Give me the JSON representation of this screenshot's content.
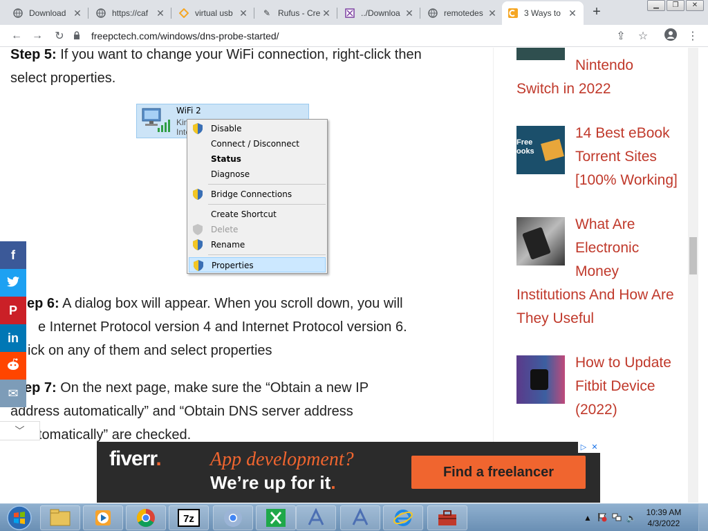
{
  "browser": {
    "tabs": [
      {
        "title": "Download",
        "icon": "globe-icon",
        "active": false
      },
      {
        "title": "https://caf",
        "icon": "globe-icon",
        "active": false
      },
      {
        "title": "virtual usb",
        "icon": "diamond-icon",
        "active": false
      },
      {
        "title": "Rufus - Cre",
        "icon": "pen-icon",
        "active": false
      },
      {
        "title": "../Downloa",
        "icon": "folder-icon",
        "active": false
      },
      {
        "title": "remotedes",
        "icon": "globe-icon",
        "active": false
      },
      {
        "title": "3 Ways to",
        "icon": "site-icon",
        "active": true
      }
    ],
    "new_tab_glyph": "+",
    "url": "freepctech.com/windows/dns-probe-started/"
  },
  "article": {
    "step5_label": "Step 5:",
    "step5_text": " If you want to change your WiFi connection, right-click then select properties.",
    "step6_label": "Step 6:",
    "step6_text": " A dialog box will appear. When you scroll down, you will see Internet Protocol version 4 and Internet Protocol version 6. Click on any of them and select properties",
    "step6_visible_a": "ep 6:",
    "step6_visible_b": " A dialog box will appear. When you scroll down, you will",
    "step6_visible_c": "e Internet Protocol version 4 and Internet Protocol version 6.",
    "step6_visible_d": "ick on any of them and select properties",
    "step7_label": "Step 7:",
    "step7_line1": " On the next page, make sure the “Obtain a new IP",
    "step7_line2": "address automatically” and “Obtain DNS server address",
    "step7_line3": "tomatically” are checked."
  },
  "context_menu": {
    "wifi_name": "WiFi 2",
    "wifi_sub1": "Kin",
    "wifi_sub2": "Inte",
    "items": [
      {
        "label": "Disable",
        "shield": true,
        "style": "normal"
      },
      {
        "label": "Connect / Disconnect",
        "shield": false,
        "style": "normal"
      },
      {
        "label": "Status",
        "shield": false,
        "style": "bold"
      },
      {
        "label": "Diagnose",
        "shield": false,
        "style": "normal"
      },
      {
        "label": "Bridge Connections",
        "shield": true,
        "style": "normal"
      },
      {
        "label": "Create Shortcut",
        "shield": false,
        "style": "normal"
      },
      {
        "label": "Delete",
        "shield": true,
        "style": "disabled"
      },
      {
        "label": "Rename",
        "shield": true,
        "style": "normal"
      },
      {
        "label": "Properties",
        "shield": true,
        "style": "highlighted"
      }
    ]
  },
  "social": [
    {
      "name": "facebook",
      "glyph": "f",
      "color": "#3b5998"
    },
    {
      "name": "twitter",
      "glyph": "🐦",
      "color": "#1da1f2"
    },
    {
      "name": "pinterest",
      "glyph": "P",
      "color": "#cb2027"
    },
    {
      "name": "linkedin",
      "glyph": "in",
      "color": "#0077b5"
    },
    {
      "name": "reddit",
      "glyph": "●",
      "color": "#ff4500"
    },
    {
      "name": "email",
      "glyph": "✉",
      "color": "#7d9cb8"
    }
  ],
  "sidebar": {
    "post0_a": "Nintendo",
    "post0_b": "Switch in 2022",
    "post1_a": "14 Best eBook",
    "post1_b": "Torrent Sites",
    "post1_c": "[100% Working]",
    "post1_thumb_a": "Free",
    "post1_thumb_b": "ooks",
    "post2_a": "What Are",
    "post2_b": "Electronic",
    "post2_c": "Money",
    "post2_d": "Institutions And How Are",
    "post2_e": "They Useful",
    "post3_a": "How to Update",
    "post3_b": "Fitbit Device",
    "post3_c": "(2022)",
    "link_color": "#c0392b"
  },
  "ad": {
    "brand": "fiverr",
    "brand_dot": ".",
    "line1": "App development?",
    "line2": "We’re up for it",
    "line2_dot": ".",
    "cta": "Find a freelancer",
    "accent": "#f0652f"
  },
  "taskbar": {
    "time": "10:39 AM",
    "date": "4/3/2022"
  }
}
